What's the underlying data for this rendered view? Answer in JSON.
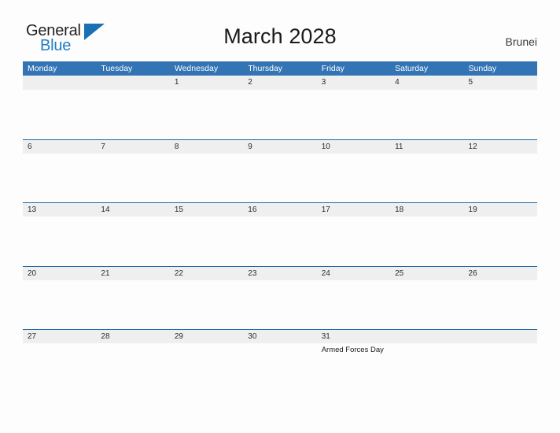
{
  "brand": {
    "name_part1": "General",
    "name_part2": "Blue",
    "flag_icon": "blue-triangle-flag-icon",
    "accent_color": "#1a6fb5"
  },
  "header": {
    "title": "March 2028",
    "region": "Brunei"
  },
  "colors": {
    "header_blue": "#3274b4",
    "row_rule_blue": "#1d6aab",
    "band_gray": "#efefef",
    "page_background": "#fdfdfd",
    "text_dark": "#2b2b2b",
    "text_white": "#ffffff"
  },
  "calendar": {
    "weekdays": [
      "Monday",
      "Tuesday",
      "Wednesday",
      "Thursday",
      "Friday",
      "Saturday",
      "Sunday"
    ],
    "weeks": [
      {
        "days": [
          {
            "num": "",
            "events": []
          },
          {
            "num": "",
            "events": []
          },
          {
            "num": "1",
            "events": []
          },
          {
            "num": "2",
            "events": []
          },
          {
            "num": "3",
            "events": []
          },
          {
            "num": "4",
            "events": []
          },
          {
            "num": "5",
            "events": []
          }
        ]
      },
      {
        "days": [
          {
            "num": "6",
            "events": []
          },
          {
            "num": "7",
            "events": []
          },
          {
            "num": "8",
            "events": []
          },
          {
            "num": "9",
            "events": []
          },
          {
            "num": "10",
            "events": []
          },
          {
            "num": "11",
            "events": []
          },
          {
            "num": "12",
            "events": []
          }
        ]
      },
      {
        "days": [
          {
            "num": "13",
            "events": []
          },
          {
            "num": "14",
            "events": []
          },
          {
            "num": "15",
            "events": []
          },
          {
            "num": "16",
            "events": []
          },
          {
            "num": "17",
            "events": []
          },
          {
            "num": "18",
            "events": []
          },
          {
            "num": "19",
            "events": []
          }
        ]
      },
      {
        "days": [
          {
            "num": "20",
            "events": []
          },
          {
            "num": "21",
            "events": []
          },
          {
            "num": "22",
            "events": []
          },
          {
            "num": "23",
            "events": []
          },
          {
            "num": "24",
            "events": []
          },
          {
            "num": "25",
            "events": []
          },
          {
            "num": "26",
            "events": []
          }
        ]
      },
      {
        "days": [
          {
            "num": "27",
            "events": []
          },
          {
            "num": "28",
            "events": []
          },
          {
            "num": "29",
            "events": []
          },
          {
            "num": "30",
            "events": []
          },
          {
            "num": "31",
            "events": [
              "Armed Forces Day"
            ]
          },
          {
            "num": "",
            "events": []
          },
          {
            "num": "",
            "events": []
          }
        ]
      }
    ]
  }
}
